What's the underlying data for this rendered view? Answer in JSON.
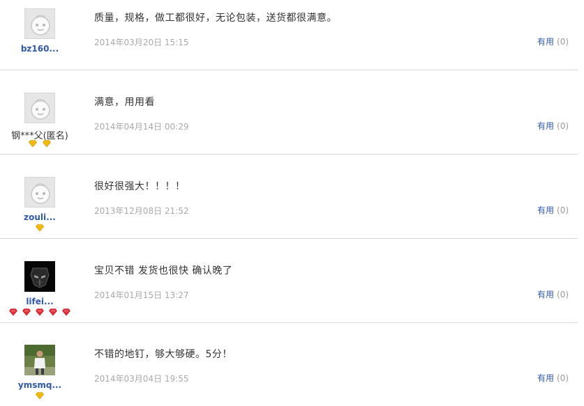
{
  "reviews": [
    {
      "username": "bz160...",
      "comment": "质量，规格，做工都很好，无论包装，送货都很满意。",
      "date": "2014年03月20日 15:15",
      "useful_label": "有用",
      "useful_count": "(0)",
      "avatar": "default-avatar",
      "badges": []
    },
    {
      "username": "钢***父(匿名)",
      "comment": "满意，用用看",
      "date": "2014年04月14日 00:29",
      "useful_label": "有用",
      "useful_count": "(0)",
      "avatar": "default-avatar",
      "badges": [
        "gold-heart",
        "gold-heart"
      ]
    },
    {
      "username": "zouli...",
      "comment": "很好很强大！！！！",
      "date": "2013年12月08日 21:52",
      "useful_label": "有用",
      "useful_count": "(0)",
      "avatar": "default-avatar",
      "badges": [
        "gold-heart"
      ]
    },
    {
      "username": "lifei...",
      "comment": "宝贝不错 发货也很快 确认晚了",
      "date": "2014年01月15日 13:27",
      "useful_label": "有用",
      "useful_count": "(0)",
      "avatar": "dark-robot-avatar",
      "badges": [
        "red-diamond",
        "red-diamond",
        "red-diamond",
        "red-diamond",
        "red-diamond"
      ]
    },
    {
      "username": "ymsmq...",
      "comment": "不错的地钉，够大够硬。5分！",
      "date": "2014年03月04日 19:55",
      "useful_label": "有用",
      "useful_count": "(0)",
      "avatar": "photo-avatar",
      "badges": [
        "gold-heart"
      ]
    }
  ],
  "colors": {
    "username_link": "#2f5aa8",
    "date": "#a9a9a9",
    "separator": "#d8d8d8",
    "gold_badge": "#f2b90f",
    "red_badge": "#e5313a"
  }
}
